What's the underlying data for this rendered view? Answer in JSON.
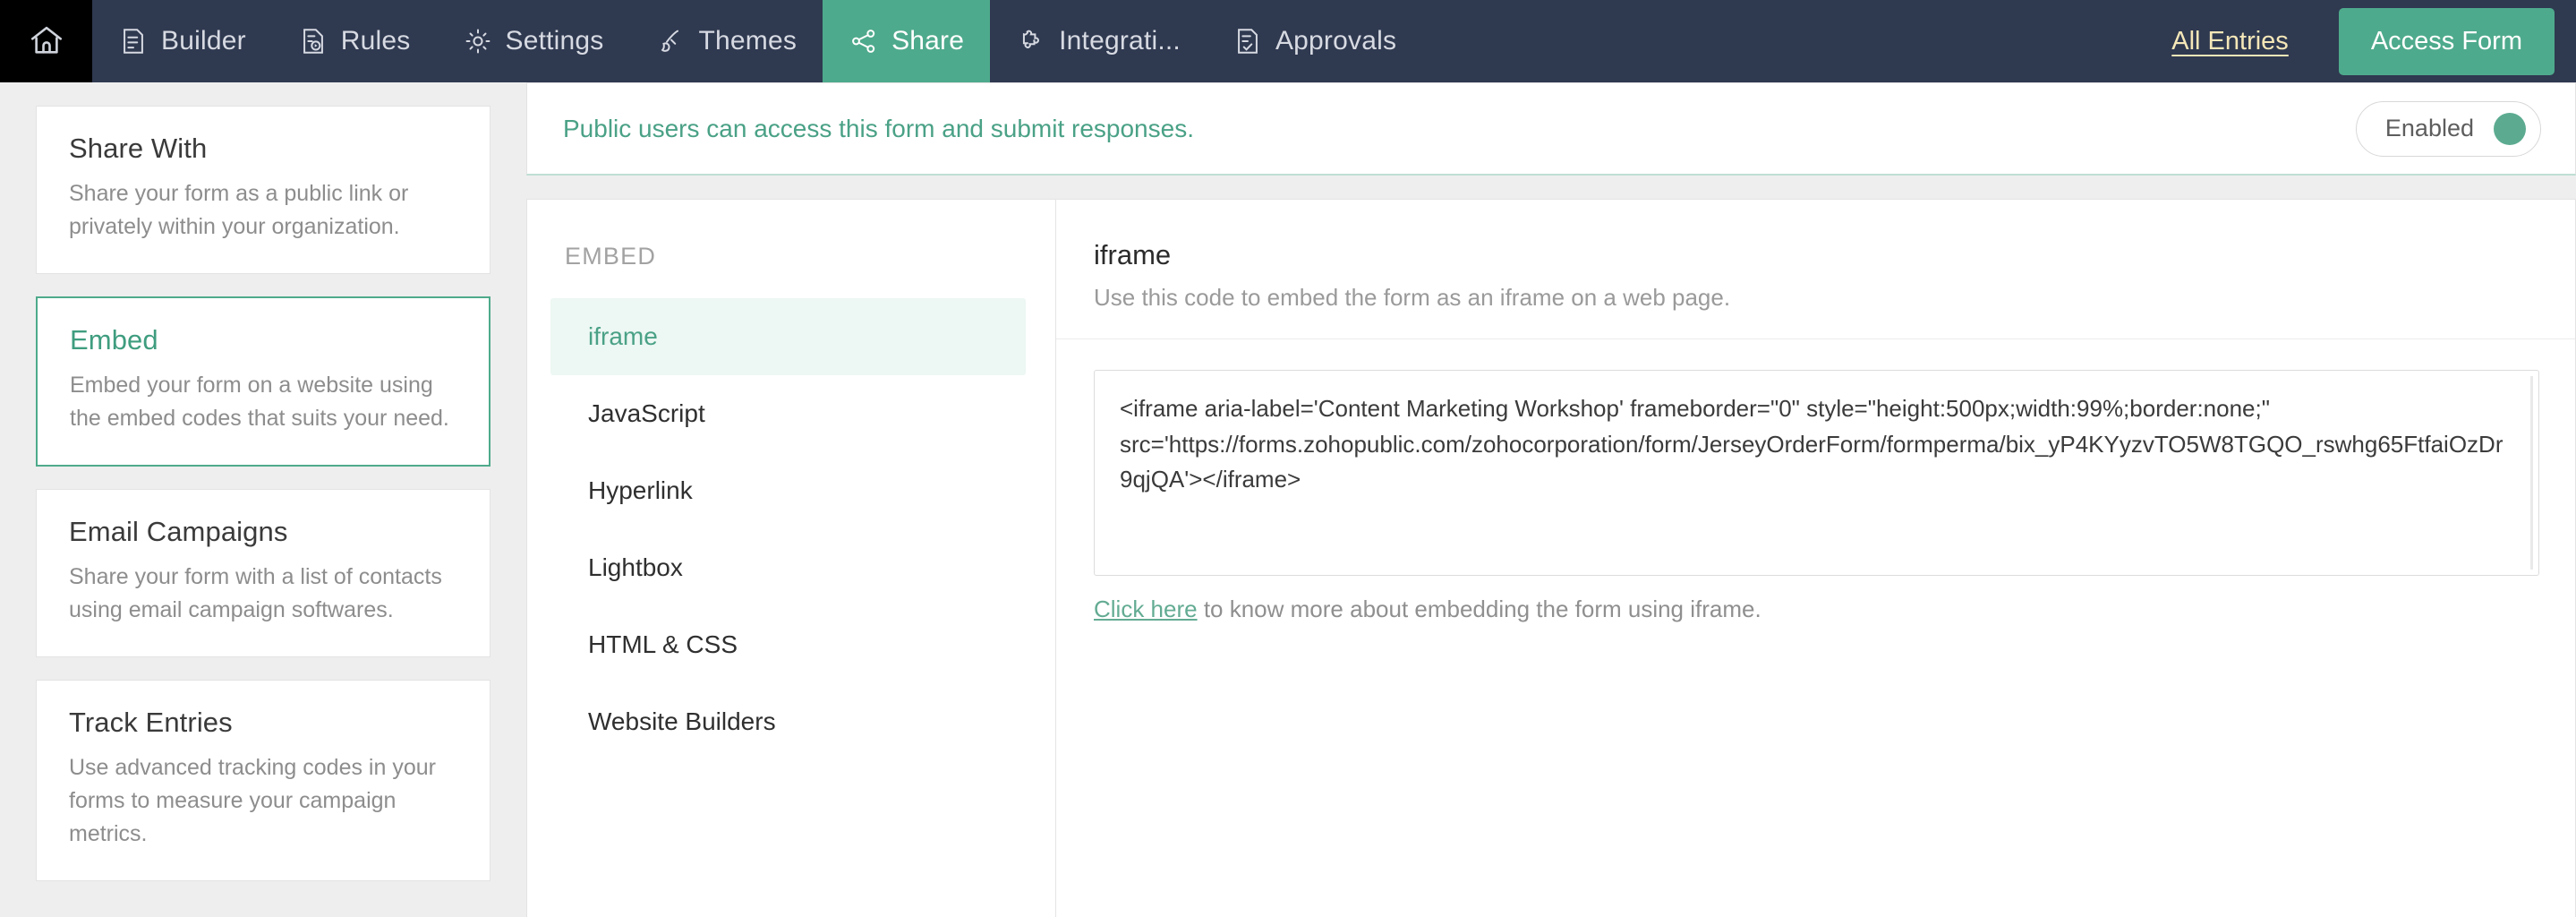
{
  "nav": {
    "home_icon": "home-icon",
    "tabs": [
      {
        "label": "Builder",
        "icon": "builder-icon",
        "active": false
      },
      {
        "label": "Rules",
        "icon": "rules-icon",
        "active": false
      },
      {
        "label": "Settings",
        "icon": "gear-icon",
        "active": false
      },
      {
        "label": "Themes",
        "icon": "brush-icon",
        "active": false
      },
      {
        "label": "Share",
        "icon": "share-nodes-icon",
        "active": true
      },
      {
        "label": "Integrati...",
        "icon": "puzzle-icon",
        "active": false
      },
      {
        "label": "Approvals",
        "icon": "approvals-icon",
        "active": false
      }
    ],
    "all_entries_label": "All Entries",
    "access_form_label": "Access Form"
  },
  "sidebar": {
    "items": [
      {
        "title": "Share With",
        "desc": "Share your form as a public link or privately within your organization.",
        "active": false
      },
      {
        "title": "Embed",
        "desc": "Embed your form on a website using the embed codes that suits your need.",
        "active": true
      },
      {
        "title": "Email Campaigns",
        "desc": "Share your form with a list of contacts using email campaign softwares.",
        "active": false
      },
      {
        "title": "Track Entries",
        "desc": "Use advanced tracking codes in your forms to measure your campaign metrics.",
        "active": false
      }
    ]
  },
  "banner": {
    "message": "Public users can access this form and submit responses.",
    "toggle_label": "Enabled",
    "toggle_state": "on"
  },
  "embed": {
    "section_label": "EMBED",
    "items": [
      {
        "label": "iframe",
        "active": true
      },
      {
        "label": "JavaScript",
        "active": false
      },
      {
        "label": "Hyperlink",
        "active": false
      },
      {
        "label": "Lightbox",
        "active": false
      },
      {
        "label": "HTML & CSS",
        "active": false
      },
      {
        "label": "Website Builders",
        "active": false
      }
    ],
    "detail": {
      "title": "iframe",
      "subtitle": "Use this code to embed the form as an iframe on a web page.",
      "code": "<iframe aria-label='Content Marketing Workshop' frameborder=\"0\" style=\"height:500px;width:99%;border:none;\" src='https://forms.zohopublic.com/zohocorporation/form/JerseyOrderForm/formperma/bix_yP4KYyzvTO5W8TGQO_rswhg65FtfaiOzDr9qjQA'></iframe>",
      "help_link": "Click here",
      "help_text": " to know more about embedding the form using iframe."
    }
  },
  "colors": {
    "navbar": "#2f3950",
    "home_cell": "#000000",
    "accent_green": "#4eaa8c",
    "all_entries": "#f5e7b8",
    "page_bg": "#eeeeee",
    "banner_text": "#4aa186",
    "active_menu_bg": "#edf7f3"
  }
}
